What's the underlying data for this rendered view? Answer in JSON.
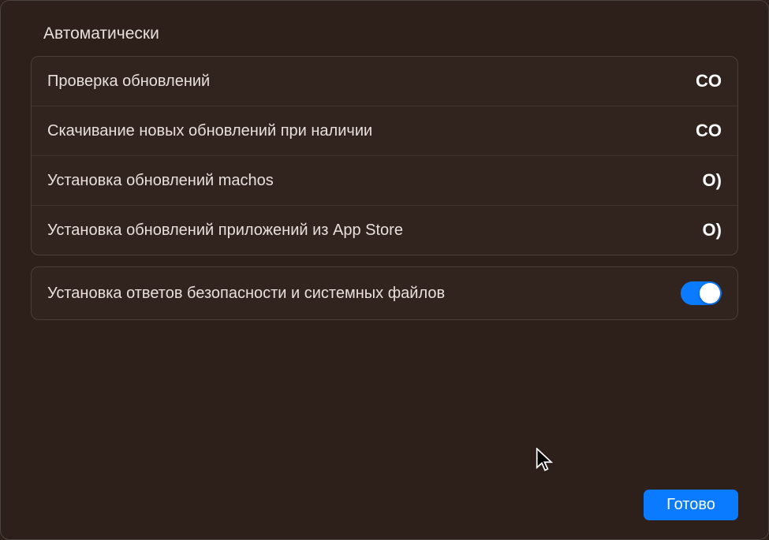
{
  "section_title": "Автоматически",
  "group1": {
    "items": [
      {
        "label": "Проверка обновлений",
        "value": "CO"
      },
      {
        "label": "Скачивание новых обновлений при наличии",
        "value": "CO"
      },
      {
        "label": "Установка обновлений machos",
        "value": "O)"
      },
      {
        "label": "Установка обновлений приложений из App Store",
        "value": "O)"
      }
    ]
  },
  "group2": {
    "items": [
      {
        "label": "Установка ответов безопасности и системных файлов",
        "toggle_on": true
      }
    ]
  },
  "done_button": "Готово",
  "colors": {
    "background": "#2d1f1a",
    "accent": "#0a7aff",
    "text": "#e8e0dc",
    "border": "#4a3f3a"
  }
}
